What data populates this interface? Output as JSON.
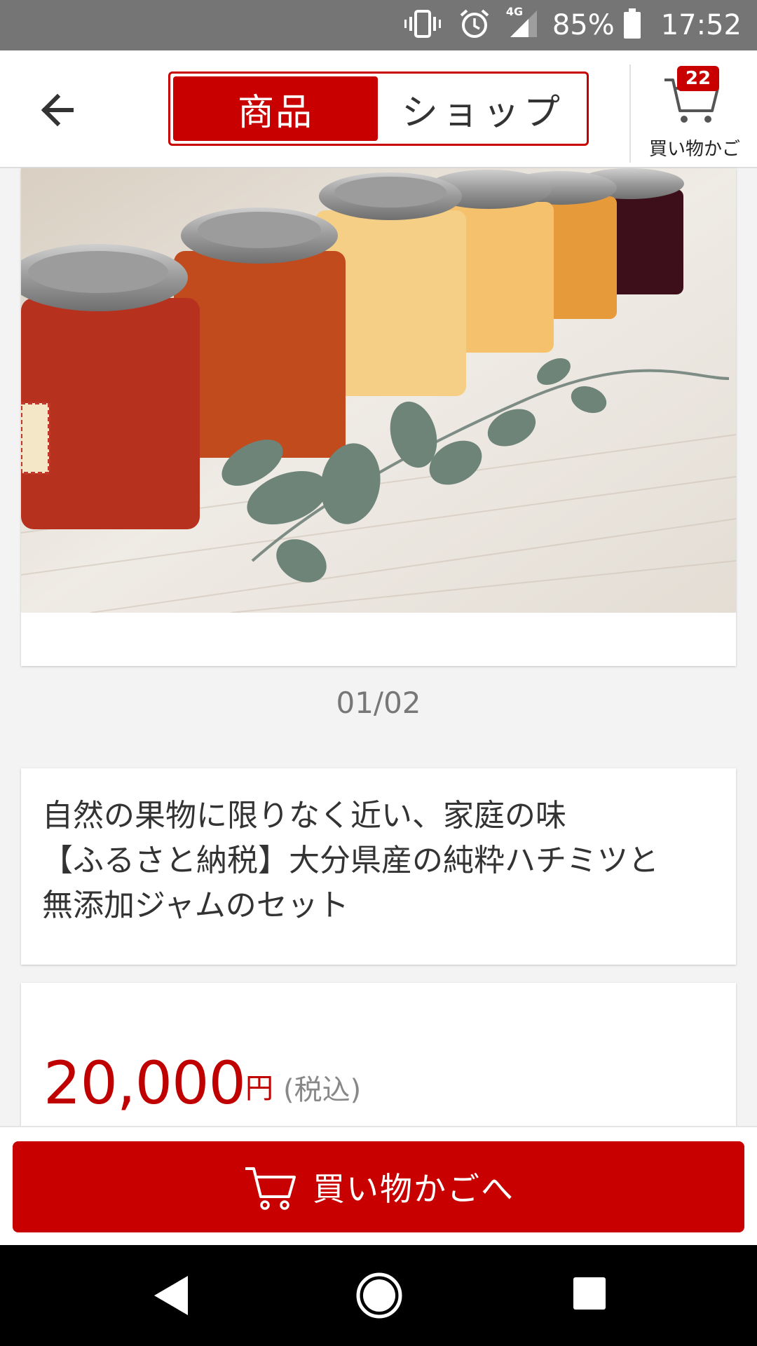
{
  "status_bar": {
    "network": "4G",
    "battery": "85%",
    "time": "17:52",
    "icons": [
      "vibrate-icon",
      "alarm-icon",
      "signal-icon",
      "battery-icon"
    ]
  },
  "header": {
    "back_icon": "arrow-left-icon",
    "tabs": [
      {
        "label": "商品",
        "selected": true
      },
      {
        "label": "ショップ",
        "selected": false
      }
    ],
    "cart": {
      "count": "22",
      "label": "買い物かご",
      "icon": "cart-icon"
    }
  },
  "gallery": {
    "pager": "01/02"
  },
  "product": {
    "title_lines": [
      "自然の果物に限りなく近い、家庭の味",
      "【ふるさと納税】大分県産の純粋ハチミツと",
      "無添加ジャムのセット"
    ],
    "price": "20,000",
    "currency": "円",
    "tax_note": "(税込)"
  },
  "action": {
    "button_label": "買い物かごへ",
    "button_icon": "cart-icon"
  },
  "colors": {
    "accent": "#c80000",
    "status_bar": "#757575",
    "background": "#f3f3f3"
  }
}
